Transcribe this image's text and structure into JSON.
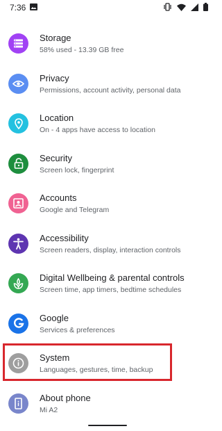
{
  "status_bar": {
    "time": "7:36",
    "icons": [
      "gallery-notification-icon",
      "vibrate-icon",
      "wifi-icon",
      "signal-icon",
      "battery-icon"
    ]
  },
  "settings": [
    {
      "icon": "storage-icon",
      "icon_color": "#a142f4",
      "title": "Storage",
      "subtitle": "58% used - 13.39 GB free"
    },
    {
      "icon": "privacy-icon",
      "icon_color": "#5b8ef2",
      "title": "Privacy",
      "subtitle": "Permissions, account activity, personal data"
    },
    {
      "icon": "location-icon",
      "icon_color": "#24c1e0",
      "title": "Location",
      "subtitle": "On - 4 apps have access to location"
    },
    {
      "icon": "security-icon",
      "icon_color": "#1e8e3e",
      "title": "Security",
      "subtitle": "Screen lock, fingerprint"
    },
    {
      "icon": "accounts-icon",
      "icon_color": "#f06292",
      "title": "Accounts",
      "subtitle": "Google and Telegram"
    },
    {
      "icon": "accessibility-icon",
      "icon_color": "#5e35b1",
      "title": "Accessibility",
      "subtitle": "Screen readers, display, interaction controls"
    },
    {
      "icon": "digital-wellbeing-icon",
      "icon_color": "#34a853",
      "title": "Digital Wellbeing & parental controls",
      "subtitle": "Screen time, app timers, bedtime schedules"
    },
    {
      "icon": "google-icon",
      "icon_color": "#1a73e8",
      "title": "Google",
      "subtitle": "Services & preferences"
    },
    {
      "icon": "system-info-icon",
      "icon_color": "#9e9e9e",
      "title": "System",
      "subtitle": "Languages, gestures, time, backup"
    },
    {
      "icon": "about-phone-icon",
      "icon_color": "#7986cb",
      "title": "About phone",
      "subtitle": "Mi A2"
    }
  ],
  "highlight_color": "#d8272d"
}
